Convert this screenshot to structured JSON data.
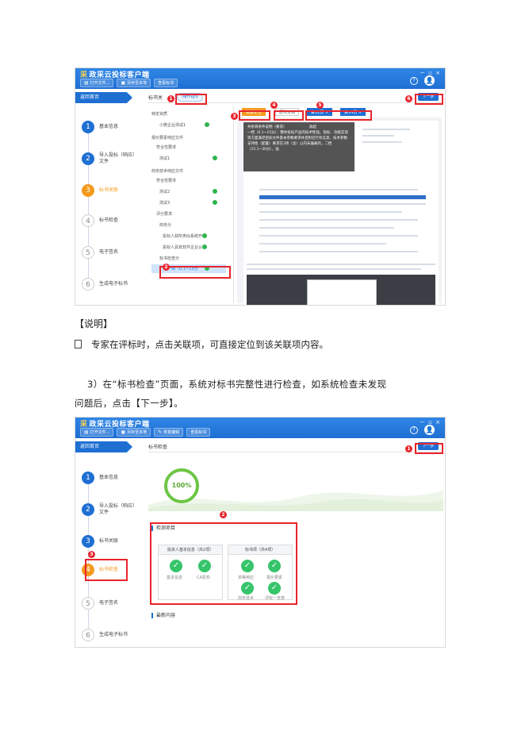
{
  "app": {
    "name": "政采云投标客户端",
    "logo_glyph": "采",
    "window_controls": "－ ▫ ×",
    "help_glyph": "?",
    "avatar_glyph": "👤"
  },
  "shot1": {
    "toolbar": [
      {
        "icon": "▤",
        "label": "打开文件..."
      },
      {
        "icon": "▣",
        "label": "另存至本地"
      },
      {
        "icon": "",
        "label": "查看标书"
      }
    ],
    "back_home": "返回首页",
    "steps": [
      {
        "num": "1",
        "label": "基本信息"
      },
      {
        "num": "2",
        "label": "导入投标（响应）文件"
      },
      {
        "num": "3",
        "label": "标书关联"
      },
      {
        "num": "4",
        "label": "标书检查"
      },
      {
        "num": "5",
        "label": "电子签名"
      },
      {
        "num": "6",
        "label": "生成电子标书"
      }
    ],
    "header_title": "标书关",
    "op_guide": "?操作指引",
    "next": "下一步",
    "tree": [
      "特定资质",
      "小微企业测试1",
      "报价要素响应文件",
      "符合性要求",
      "测试1",
      "商务技术响应文件",
      "符合性要求",
      "测试2",
      "测试3",
      "评分要求",
      "商务分",
      "投标人获所类似系统开",
      "投标人具有软件企业认",
      "标书检查分",
      "一档（0.1~15分"
    ],
    "tabs": [
      "关联定位",
      "原件文档",
      "第12页 ×",
      "第14页 ×"
    ],
    "tooltip": "共条目条件说明（要求）                    收起\n一档（0.1~15分）：整体投标产品的技术性强，指标、功能实现等方面满足招标文件基本参数要求并且附近行有信息，技术参数支持性（配置）要求在3项（含）以内未偏离的，二档（15.1~30分），描"
  },
  "notes": {
    "heading": "【说明】",
    "line": "专家在评标时，点击关联项，可直接定位到该关联项内容。",
    "para_line1": "3）在“标书检查”页面，系统对标书完整性进行检查，如系统检查未发现",
    "para_line2": "问题后，点击【下一步】。"
  },
  "shot2": {
    "toolbar": [
      {
        "icon": "▤",
        "label": "打开文件..."
      },
      {
        "icon": "▣",
        "label": "另存至本地"
      },
      {
        "icon": "✎",
        "label": "恢复编辑"
      },
      {
        "icon": "",
        "label": "查看标书"
      }
    ],
    "back_home": "返回首页",
    "steps": [
      {
        "num": "1",
        "label": "基本信息"
      },
      {
        "num": "2",
        "label": "导入投标（响应）文件"
      },
      {
        "num": "3",
        "label": "标书关联"
      },
      {
        "num": "4",
        "label": "标书检查"
      },
      {
        "num": "5",
        "label": "电子签名"
      },
      {
        "num": "6",
        "label": "生成电子标书"
      }
    ],
    "header_title": "标书检查",
    "next": "下一步",
    "progress_label": "100%",
    "progress_value": 100,
    "check_section": "检测项目",
    "latest_section": "最新内容",
    "card1_title": "投资人基本信息（共2项）",
    "card1_items": [
      "基本信息",
      "CA机构"
    ],
    "card2_title": "标书项（共4项）",
    "card2_items": [
      "资格响应",
      "报价要素",
      "商务技术",
      "评标一览表"
    ]
  },
  "badges": [
    "1",
    "2",
    "3",
    "4",
    "5",
    "6"
  ]
}
